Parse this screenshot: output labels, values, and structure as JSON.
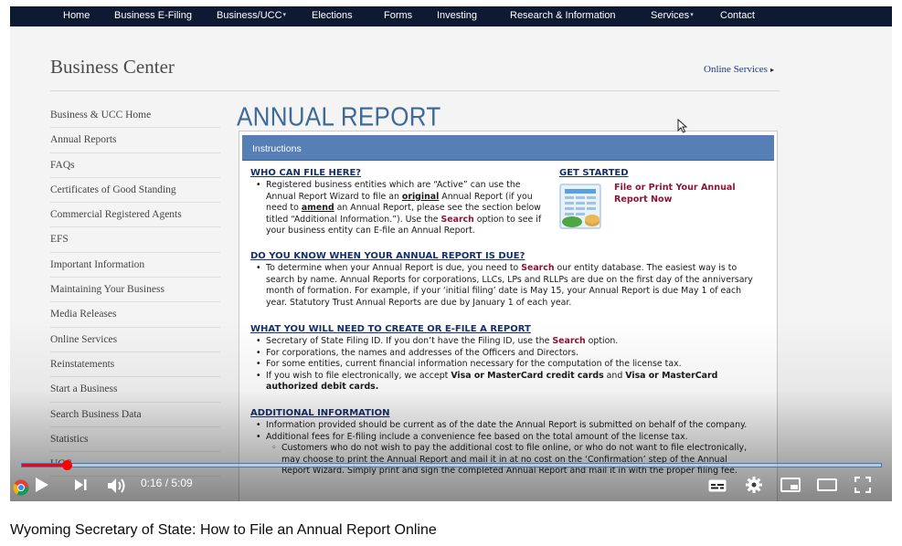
{
  "site_nav": {
    "items": [
      {
        "label": "Home",
        "has_menu": false
      },
      {
        "label": "Business E-Filing",
        "has_menu": false
      },
      {
        "label": "Business/UCC",
        "has_menu": true
      },
      {
        "label": "Elections",
        "has_menu": false
      },
      {
        "label": "Forms",
        "has_menu": false
      },
      {
        "label": "Investing",
        "has_menu": false
      },
      {
        "label": "Research & Information",
        "has_menu": false
      },
      {
        "label": "Services",
        "has_menu": true
      },
      {
        "label": "Contact",
        "has_menu": false
      }
    ]
  },
  "header": {
    "title": "Business Center",
    "online_services": "Online Services",
    "online_services_arrow": "▸"
  },
  "sidebar": {
    "items": [
      {
        "label": "Business & UCC Home"
      },
      {
        "label": "Annual Reports"
      },
      {
        "label": "FAQs"
      },
      {
        "label": "Certificates of Good Standing"
      },
      {
        "label": "Commercial Registered Agents"
      },
      {
        "label": "EFS"
      },
      {
        "label": "Important Information"
      },
      {
        "label": "Maintaining Your Business"
      },
      {
        "label": "Media Releases"
      },
      {
        "label": "Online Services"
      },
      {
        "label": "Reinstatements"
      },
      {
        "label": "Start a Business"
      },
      {
        "label": "Search Business Data"
      },
      {
        "label": "Statistics"
      },
      {
        "label": "UCC"
      }
    ]
  },
  "main": {
    "title": "ANNUAL REPORT",
    "panel_heading": "Instructions",
    "who_can_file": {
      "heading": "WHO CAN FILE HERE?",
      "l1": "Registered business entities which are “Active” can use the",
      "l2_a": "Annual Report Wizard to file an ",
      "l2_b": "original",
      "l2_c": " Annual Report (if you",
      "l3_a": "need to ",
      "l3_b": "amend",
      "l3_c": " an Annual Report, please see the section below",
      "l4": "titled “Additional Information.”). Use the ",
      "l4_search": "Search",
      "l4_c": " option to see if",
      "l5": "your business entity can E-file an Annual Report."
    },
    "get_started": {
      "heading": "GET STARTED",
      "link": "File or Print Your Annual Report Now",
      "icon": "report-document-icon"
    },
    "when_due": {
      "heading": "DO YOU KNOW WHEN YOUR ANNUAL REPORT IS DUE?",
      "l1_a": "To determine when your Annual Report is due, you need to ",
      "l1_b": "Search",
      "l1_c": " our entity database. The easiest way is to",
      "l2": "search by name. Annual Reports for corporations, LLCs, LPs and RLLPs are due on the first day of the anniversary",
      "l3": "month of formation. For example, if your ‘initial filing’ date is May 15, your Annual Report is due May 1 of each",
      "l4": "year. Statutory Trust Annual Reports are due by January 1 of each year."
    },
    "what_you_need": {
      "heading": "WHAT YOU WILL NEED TO CREATE OR E-FILE A REPORT",
      "b1_a": "Secretary of State Filing ID. If you don’t have the Filing ID, use the ",
      "b1_b": "Search",
      "b1_c": " option.",
      "b2": "For corporations, the names and addresses of the Officers and Directors.",
      "b3": "For some entities, current financial information necessary for the computation of the license tax.",
      "b4_a": "If you wish to file electronically, we accept ",
      "b4_b": "Visa or MasterCard credit cards",
      "b4_c": " and ",
      "b4_d": "Visa or MasterCard",
      "b4_e": "authorized debit cards."
    },
    "additional": {
      "heading": "ADDITIONAL INFORMATION",
      "b1": "Information provided should be current as of the date the Annual Report is submitted on behalf of the company.",
      "b2": "Additional fees for E-filing include a convenience fee based on the total amount of the license tax.",
      "s1": "Customers who do not wish to pay the additional cost to file online, or who do not want to file electronically,",
      "s2": "may choose to print the Annual Report and mail it in at no cost on the ‘Confirmation’ step of the Annual",
      "s3": "Report Wizard. Simply print and sign the completed Annual Report and mail it in with the proper filing fee."
    }
  },
  "player": {
    "time_current": "0:16",
    "time_separator": " / ",
    "time_total": "5:09",
    "progress_fraction": 0.052,
    "accent": "#ff0000"
  },
  "video_title": "Wyoming Secretary of State: How to File an Annual Report Online"
}
